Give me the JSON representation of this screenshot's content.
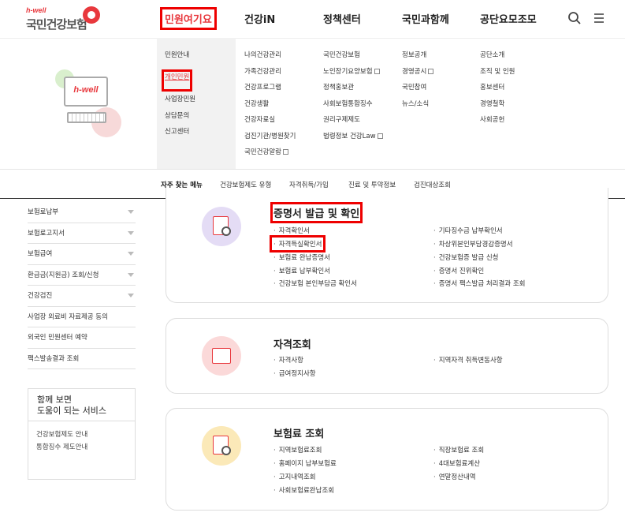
{
  "header": {
    "logo_small": "h-well",
    "logo_main": "국민건강보험",
    "nav": [
      "민원여기요",
      "건강iN",
      "정책센터",
      "국민과함께",
      "공단요모조모"
    ],
    "icons": [
      "search-icon",
      "menu-icon"
    ]
  },
  "mega": {
    "illustration_text": "h-well",
    "col1": [
      "민원안내",
      "개인민원",
      "사업장민원",
      "상담문의",
      "신고센터"
    ],
    "col2": [
      "나의건강관리",
      "가족건강관리",
      "건강프로그램",
      "건강생활",
      "건강자료실",
      "검진기관/병원찾기",
      "국민건강알람"
    ],
    "col3": [
      "국민건강보험",
      "노인장기요양보험",
      "정책홍보관",
      "사회보험통합징수",
      "권리구제제도",
      "법령정보 건강Law"
    ],
    "col4": [
      "정보공개",
      "경영공시",
      "국민참여",
      "뉴스/소식"
    ],
    "col5": [
      "공단소개",
      "조직 및 인원",
      "홍보센터",
      "경영철학",
      "사회공헌"
    ]
  },
  "quick_bar": [
    "자주 찾는 메뉴",
    "건강보험제도 유형",
    "자격취득/가입",
    "진료 및 투약정보",
    "검진대상조회"
  ],
  "sidebar": {
    "items": [
      {
        "label": "보험료납부",
        "arrow": true
      },
      {
        "label": "보험료고지서",
        "arrow": true
      },
      {
        "label": "보험급여",
        "arrow": true
      },
      {
        "label": "환급금(지원금) 조회/신청",
        "arrow": true
      },
      {
        "label": "건강검진",
        "arrow": true
      },
      {
        "label": "사업장 외료비 자료제공 동의",
        "arrow": false
      },
      {
        "label": "외국인 민원센터 예약",
        "arrow": false
      },
      {
        "label": "팩스발송결과 조회",
        "arrow": false
      }
    ],
    "service_title": "함께 보면\n도움이 되는 서비스",
    "service_links": [
      "건강보험제도 안내",
      "통합징수 제도안내"
    ]
  },
  "cards": [
    {
      "title": "증명서 발급 및 확인",
      "left": [
        "자격확인서",
        "자격득실확인서",
        "보험료 완납증명서",
        "보험료 납부확인서",
        "건강보험 본인부담금 확인서"
      ],
      "right": [
        "기타징수금 납부확인서",
        "차상위본인부담경감증명서",
        "건강보험증 발급 신청",
        "증명서 진위확인",
        "증명서 팩스발급 처리결과 조회"
      ],
      "icon_color": "#e4dcf5"
    },
    {
      "title": "자격조회",
      "left": [
        "자격사항",
        "급여정지사항"
      ],
      "right": [
        "지역자격 취득변동사항"
      ],
      "icon_color": "#fbd9d9"
    },
    {
      "title": "보험료 조회",
      "left": [
        "지역보험료조회",
        "홈페이지 납부보험료",
        "고지내역조회",
        "사회보험료완납조회"
      ],
      "right": [
        "직장보험료 조회",
        "4대보험료계산",
        "연말정산내역"
      ],
      "icon_color": "#fbe9b8"
    }
  ],
  "colors": {
    "accent": "#e8383d",
    "highlight_box": "#ee0000"
  }
}
